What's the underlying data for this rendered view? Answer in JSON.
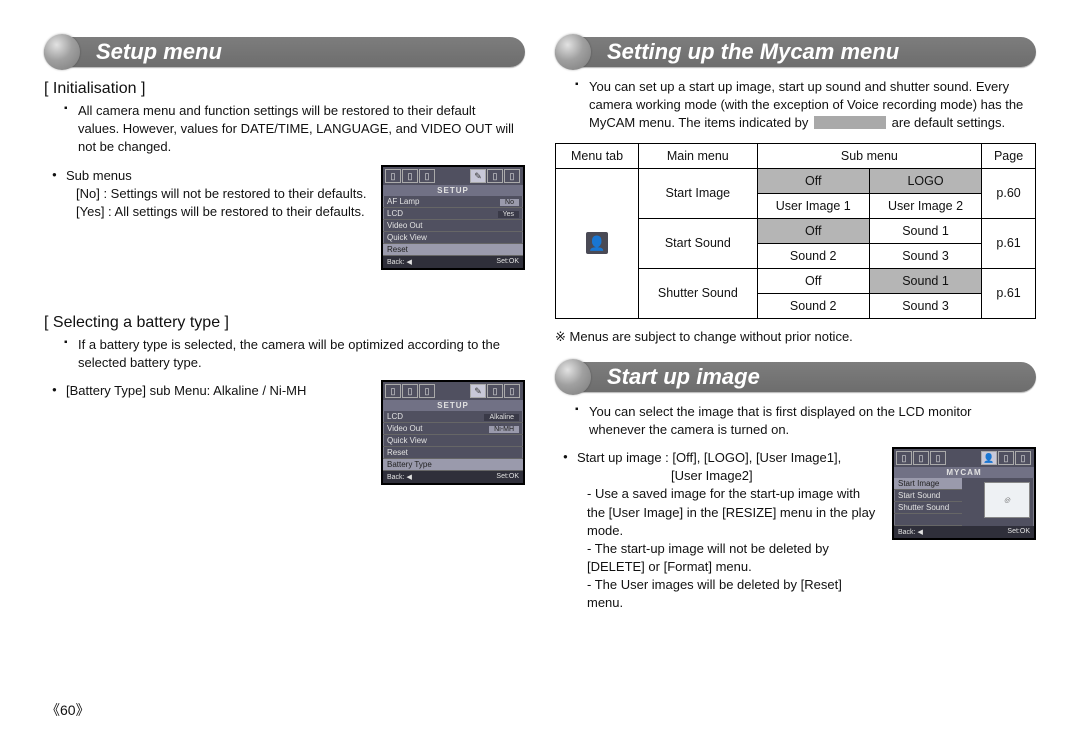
{
  "page_number": "60",
  "left": {
    "pill": "Setup menu",
    "init": {
      "title": "[ Initialisation ]",
      "intro": "All camera menu and function settings will be restored to their default values. However, values for DATE/TIME, LANGUAGE, and VIDEO OUT will not be changed.",
      "sub_label": "Sub menus",
      "no_line": "[No]   : Settings will not be restored to their defaults.",
      "yes_line": "[Yes]  : All settings will be restored to their defaults.",
      "lcd": {
        "header": "SETUP",
        "rows": [
          "AF Lamp",
          "LCD",
          "Video Out",
          "Quick View",
          "Reset"
        ],
        "sel_index": 4,
        "val_no": "No",
        "val_yes": "Yes",
        "back": "Back: ◀",
        "ok": "Set:OK"
      }
    },
    "batt": {
      "title": "[ Selecting a battery type ]",
      "intro": "If a battery type is selected, the camera will be optimized according to the selected battery type.",
      "sub": "[Battery Type] sub Menu: Alkaline / Ni-MH",
      "lcd": {
        "header": "SETUP",
        "rows": [
          "LCD",
          "Video Out",
          "Quick View",
          "Reset",
          "Battery Type"
        ],
        "sel_index": 4,
        "val_top": "Alkaline",
        "val_sel": "Ni-MH",
        "back": "Back: ◀",
        "ok": "Set:OK"
      }
    }
  },
  "right": {
    "pill1": "Setting up the Mycam menu",
    "intro1a": "You can set up a start up image, start up sound and shutter sound. Every camera working mode (with the exception of Voice recording mode) has the MyCAM menu. The items indicated by ",
    "intro1b": " are default settings.",
    "table": {
      "head": [
        "Menu tab",
        "Main menu",
        "Sub menu",
        "Page"
      ],
      "icon": "👤",
      "rows": [
        {
          "menu": "Start Image",
          "r1": [
            "Off",
            "LOGO"
          ],
          "r2": [
            "User Image 1",
            "User Image 2"
          ],
          "page": "p.60",
          "shade": [
            true,
            true,
            false,
            false
          ]
        },
        {
          "menu": "Start Sound",
          "r1": [
            "Off",
            "Sound 1"
          ],
          "r2": [
            "Sound 2",
            "Sound 3"
          ],
          "page": "p.61",
          "shade": [
            true,
            false,
            false,
            false
          ]
        },
        {
          "menu": "Shutter Sound",
          "r1": [
            "Off",
            "Sound 1"
          ],
          "r2": [
            "Sound 2",
            "Sound 3"
          ],
          "page": "p.61",
          "shade": [
            false,
            true,
            false,
            false
          ]
        }
      ]
    },
    "note": "Menus are subject to change without prior notice.",
    "pill2": "Start up image",
    "intro2": "You can select the image that is first displayed on the LCD monitor whenever the camera is turned on.",
    "opts_label": "Start up image : [Off], [LOGO], [User Image1],",
    "opts_label2": "[User Image2]",
    "dash1": "- Use a saved image for the start-up image with the [User Image] in the [RESIZE] menu in the play mode.",
    "dash2": "- The start-up image will not be deleted by [DELETE] or [Format] menu.",
    "dash3": "- The User images will be deleted by [Reset] menu.",
    "lcd": {
      "header": "MYCAM",
      "rows": [
        "Start Image",
        "Start Sound",
        "Shutter Sound"
      ],
      "sel_index": 0,
      "back": "Back: ◀",
      "ok": "Set:OK"
    }
  }
}
